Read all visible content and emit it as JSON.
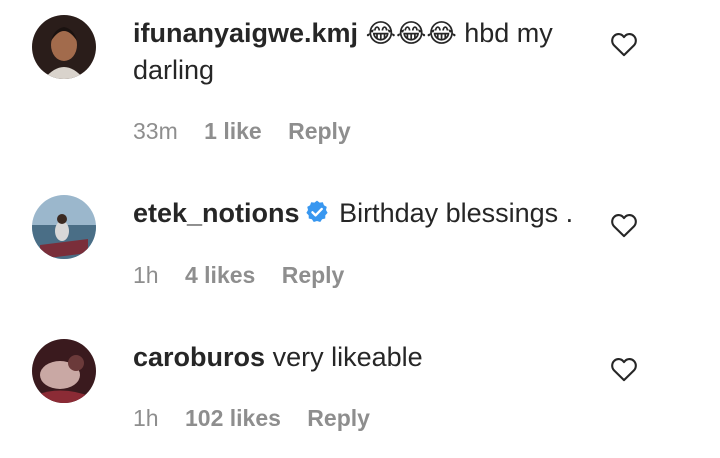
{
  "comments": [
    {
      "username": "ifunanyaigwe.kmj",
      "emoji": "😂😂😂",
      "text": "hbd my darling",
      "time": "33m",
      "likes": "1 like",
      "reply": "Reply",
      "verified": false
    },
    {
      "username": "etek_notions",
      "emoji": "",
      "text": "Birthday blessings .",
      "time": "1h",
      "likes": "4 likes",
      "reply": "Reply",
      "verified": true
    },
    {
      "username": "caroburos",
      "emoji": "",
      "text": "very likeable",
      "time": "1h",
      "likes": "102 likes",
      "reply": "Reply",
      "verified": false
    }
  ],
  "colors": {
    "text": "#262626",
    "meta": "#8e8e8e",
    "verified": "#3897f0"
  },
  "icons": {
    "like": "heart-outline-icon",
    "verified": "verified-badge-icon"
  }
}
